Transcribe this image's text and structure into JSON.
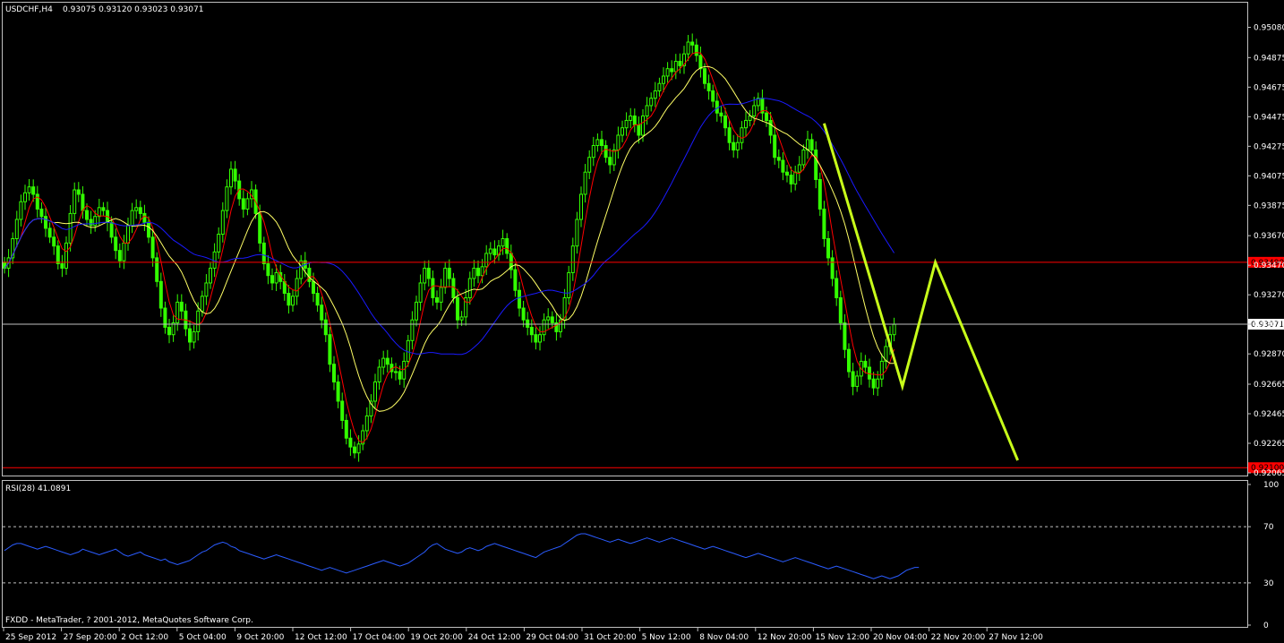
{
  "header": {
    "symbol": "USDCHF,H4",
    "ohlc": "0.93075 0.93120 0.93023 0.93071"
  },
  "footer": {
    "copyright": "FXDD - MetaTrader, ? 2001-2012, MetaQuotes Software Corp."
  },
  "colors": {
    "background": "#000000",
    "frame": "#c0c0c0",
    "candle": "#33ff00",
    "fast_ma": "#ff0000",
    "slow_ma": "#ffff66",
    "long_ma": "#1a1aff",
    "support_resistance": "#ff0000",
    "current_price_line": "#c0c0c0",
    "projection": "#c8ff1a",
    "rsi_line": "#2b5cff",
    "rsi_level": "#bfbfbf"
  },
  "chart_data": [
    {
      "type": "candlestick",
      "title": "USDCHF,H4",
      "ylim": [
        0.92065,
        0.9518
      ],
      "yticks": [
        "0.95080",
        "0.94875",
        "0.94675",
        "0.94475",
        "0.94275",
        "0.94075",
        "0.93875",
        "0.93670",
        "0.93470",
        "0.93270",
        "0.93071",
        "0.92870",
        "0.92665",
        "0.92465",
        "0.92265",
        "0.92065"
      ],
      "ytick_values": [
        0.9508,
        0.94875,
        0.94675,
        0.94475,
        0.94275,
        0.94075,
        0.93875,
        0.9367,
        0.9347,
        0.9327,
        0.93071,
        0.9287,
        0.92665,
        0.92465,
        0.92265,
        0.92065
      ],
      "xticks": [
        "25 Sep 2012",
        "27 Sep 20:00",
        "2 Oct 12:00",
        "5 Oct 04:00",
        "9 Oct 20:00",
        "12 Oct 12:00",
        "17 Oct 04:00",
        "19 Oct 20:00",
        "24 Oct 12:00",
        "29 Oct 04:00",
        "31 Oct 20:00",
        "5 Nov 12:00",
        "8 Nov 04:00",
        "12 Nov 20:00",
        "15 Nov 12:00",
        "20 Nov 04:00",
        "22 Nov 20:00",
        "27 Nov 12:00"
      ],
      "close_series": [
        0.9345,
        0.9352,
        0.9365,
        0.9378,
        0.939,
        0.9396,
        0.94,
        0.9395,
        0.9385,
        0.938,
        0.9372,
        0.9366,
        0.936,
        0.9348,
        0.9345,
        0.9362,
        0.9382,
        0.9398,
        0.9395,
        0.9384,
        0.9378,
        0.9374,
        0.938,
        0.9386,
        0.9384,
        0.9376,
        0.9366,
        0.9357,
        0.935,
        0.9362,
        0.9374,
        0.9384,
        0.9386,
        0.9382,
        0.9376,
        0.9366,
        0.9352,
        0.9336,
        0.9318,
        0.9305,
        0.93,
        0.9308,
        0.9322,
        0.9316,
        0.9304,
        0.9295,
        0.9302,
        0.9316,
        0.9326,
        0.9335,
        0.9345,
        0.9356,
        0.9368,
        0.9384,
        0.94,
        0.9412,
        0.9404,
        0.9392,
        0.9385,
        0.9392,
        0.9398,
        0.9382,
        0.9362,
        0.9348,
        0.934,
        0.9335,
        0.9342,
        0.9336,
        0.9328,
        0.932,
        0.9326,
        0.9338,
        0.935,
        0.9345,
        0.9336,
        0.9328,
        0.932,
        0.931,
        0.93,
        0.928,
        0.9268,
        0.9255,
        0.9242,
        0.923,
        0.9224,
        0.922,
        0.9226,
        0.9235,
        0.9245,
        0.9255,
        0.9268,
        0.9278,
        0.9284,
        0.928,
        0.9275,
        0.9275,
        0.927,
        0.9282,
        0.9296,
        0.931,
        0.9322,
        0.9335,
        0.9345,
        0.9338,
        0.9325,
        0.9322,
        0.9332,
        0.9345,
        0.9338,
        0.9325,
        0.931,
        0.9312,
        0.9325,
        0.9338,
        0.9345,
        0.934,
        0.9346,
        0.9355,
        0.9358,
        0.9354,
        0.936,
        0.9365,
        0.9355,
        0.9344,
        0.933,
        0.9318,
        0.931,
        0.9305,
        0.93,
        0.9295,
        0.93,
        0.931,
        0.9312,
        0.9308,
        0.9302,
        0.931,
        0.9325,
        0.9342,
        0.936,
        0.9378,
        0.9395,
        0.941,
        0.942,
        0.9428,
        0.9432,
        0.9428,
        0.942,
        0.9415,
        0.9425,
        0.9435,
        0.944,
        0.9445,
        0.9448,
        0.9442,
        0.9435,
        0.9448,
        0.9455,
        0.946,
        0.9465,
        0.947,
        0.9475,
        0.948,
        0.9478,
        0.9485,
        0.9482,
        0.949,
        0.9498,
        0.9496,
        0.9489,
        0.948,
        0.947,
        0.9465,
        0.9458,
        0.945,
        0.9448,
        0.944,
        0.943,
        0.9425,
        0.943,
        0.944,
        0.9445,
        0.9448,
        0.9455,
        0.946,
        0.945,
        0.9445,
        0.9435,
        0.942,
        0.9418,
        0.941,
        0.9408,
        0.9402,
        0.941,
        0.9415,
        0.9425,
        0.9432,
        0.9425,
        0.9405,
        0.9385,
        0.9365,
        0.9352,
        0.9338,
        0.9325,
        0.9308,
        0.929,
        0.9275,
        0.9265,
        0.9272,
        0.9282,
        0.9278,
        0.927,
        0.9264,
        0.927,
        0.9282,
        0.9292,
        0.93,
        0.9307
      ],
      "fast_ma_color": "#ff0000",
      "slow_ma_color": "#ffff66",
      "long_ma_color": "#1a1aff",
      "horizontal_levels": [
        {
          "label": "0.93490",
          "value": 0.9349,
          "color": "#ff0000"
        },
        {
          "label": "0.92100",
          "value": 0.921,
          "color": "#ff0000"
        },
        {
          "label": "0.93071",
          "value": 0.93071,
          "color": "#c0c0c0"
        }
      ],
      "projection": {
        "color": "#c8ff1a",
        "points": [
          {
            "bar": 199,
            "price": 0.9443
          },
          {
            "bar": 218,
            "price": 0.9265
          },
          {
            "bar": 226,
            "price": 0.9349
          },
          {
            "bar": 246,
            "price": 0.9215
          }
        ]
      }
    },
    {
      "type": "line",
      "title": "RSI(28) 41.0891",
      "ylim": [
        0,
        100
      ],
      "yticks": [
        "100",
        "70",
        "30",
        "0"
      ],
      "ytick_values": [
        100,
        70,
        30,
        0
      ],
      "levels": [
        70,
        30
      ],
      "series": [
        {
          "name": "RSI(28)",
          "values": [
            53,
            55,
            57,
            58,
            58,
            57,
            56,
            55,
            54,
            55,
            56,
            55,
            54,
            53,
            52,
            51,
            50,
            51,
            52,
            54,
            53,
            52,
            51,
            50,
            51,
            52,
            53,
            54,
            52,
            50,
            49,
            50,
            51,
            52,
            50,
            49,
            48,
            47,
            46,
            47,
            45,
            44,
            43,
            44,
            45,
            46,
            48,
            50,
            52,
            53,
            55,
            57,
            58,
            59,
            58,
            56,
            55,
            53,
            52,
            51,
            50,
            49,
            48,
            47,
            48,
            49,
            50,
            49,
            48,
            47,
            46,
            45,
            44,
            43,
            42,
            41,
            40,
            39,
            40,
            41,
            40,
            39,
            38,
            37,
            38,
            39,
            40,
            41,
            42,
            43,
            44,
            45,
            46,
            45,
            44,
            43,
            42,
            43,
            44,
            46,
            48,
            50,
            52,
            55,
            57,
            58,
            56,
            54,
            53,
            52,
            51,
            52,
            54,
            55,
            54,
            53,
            54,
            56,
            57,
            58,
            57,
            56,
            55,
            54,
            53,
            52,
            51,
            50,
            49,
            48,
            50,
            52,
            53,
            54,
            55,
            56,
            58,
            60,
            62,
            64,
            65,
            65,
            64,
            63,
            62,
            61,
            60,
            59,
            60,
            61,
            60,
            59,
            58,
            59,
            60,
            61,
            62,
            61,
            60,
            59,
            60,
            61,
            62,
            61,
            60,
            59,
            58,
            57,
            56,
            55,
            54,
            55,
            56,
            55,
            54,
            53,
            52,
            51,
            50,
            49,
            48,
            49,
            50,
            51,
            50,
            49,
            48,
            47,
            46,
            45,
            46,
            47,
            48,
            47,
            46,
            45,
            44,
            43,
            42,
            41,
            40,
            41,
            42,
            41,
            40,
            39,
            38,
            37,
            36,
            35,
            34,
            33,
            34,
            35,
            34,
            33,
            34,
            35,
            37,
            39,
            40,
            41,
            41
          ]
        }
      ]
    }
  ]
}
